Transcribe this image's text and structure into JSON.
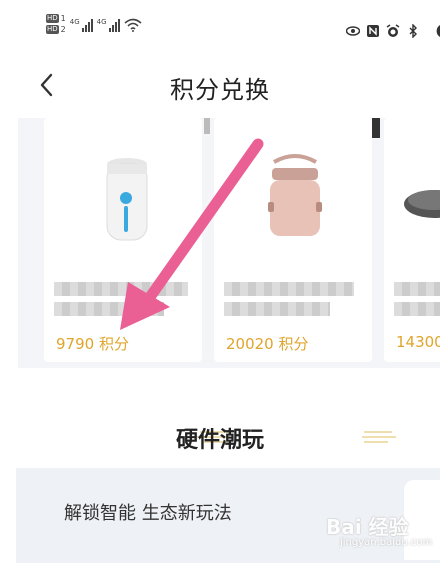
{
  "status_bar": {
    "left_badges": [
      "HD",
      "HD"
    ],
    "left_badge_nums": [
      "1",
      "2"
    ],
    "signal_labels": [
      "4G",
      "4G"
    ],
    "right_icons": [
      "eye-icon",
      "nfc-icon",
      "alarm-icon",
      "bluetooth-icon",
      "battery-icon"
    ]
  },
  "header": {
    "title": "积分兑换"
  },
  "products": [
    {
      "price": "9790 积分",
      "icon": "air-purifier-image"
    },
    {
      "price": "20020 积分",
      "icon": "lunch-box-image"
    },
    {
      "price": "14300",
      "icon": "wok-image"
    }
  ],
  "section": {
    "title": "硬件潮玩"
  },
  "banner": {
    "text": "解锁智能 生态新玩法"
  },
  "watermark": {
    "text": "Bai 经验",
    "sub": "jingyan.baidu.com"
  },
  "colors": {
    "price": "#e0a52c",
    "arrow": "#ea5f94",
    "banner_bg": "#eef1f5",
    "carousel_bg": "#f4f5f8"
  }
}
